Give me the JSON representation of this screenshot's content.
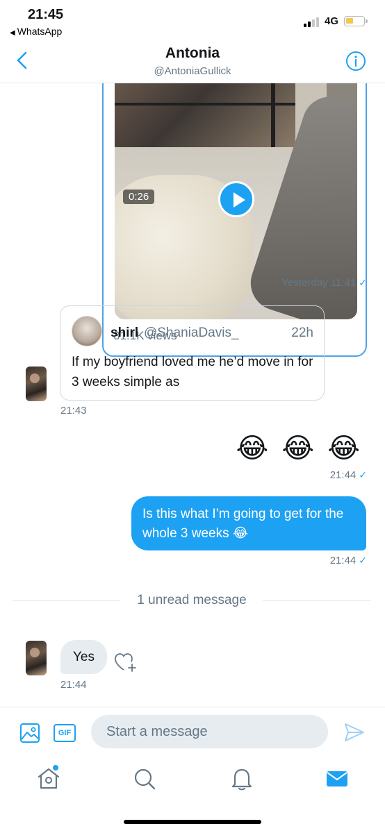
{
  "status_bar": {
    "time": "21:45",
    "back_app": "WhatsApp",
    "network": "4G"
  },
  "header": {
    "name": "Antonia",
    "handle": "@AntoniaGullick"
  },
  "messages": {
    "video": {
      "duration": "0:26",
      "views": "31.1K views",
      "timestamp": "Yesterday 11:41"
    },
    "quote_tweet": {
      "author_name": "shirl",
      "author_handle": "@ShaniaDavis_",
      "age": "22h",
      "text": "If my boyfriend loved me he’d move in for 3 weeks simple as",
      "timestamp": "21:43"
    },
    "emoji_message": {
      "text": "😂 😂 😂",
      "timestamp": "21:44"
    },
    "outgoing_text": {
      "text": "Is this what I’m going to get for the whole 3 weeks 😂",
      "timestamp": "21:44"
    },
    "unread_divider": "1 unread message",
    "incoming_text": {
      "text": "Yes",
      "timestamp": "21:44"
    }
  },
  "composer": {
    "placeholder": "Start a message",
    "gif_label": "GIF"
  },
  "colors": {
    "accent": "#1da1f2",
    "bubble_in": "#e6ecf0",
    "secondary_text": "#657786"
  },
  "icons": {
    "back": "chevron-left-icon",
    "info": "info-icon",
    "image": "image-icon",
    "gif": "gif-icon",
    "send": "send-icon",
    "home": "home-icon",
    "search": "search-icon",
    "notifications": "bell-icon",
    "messages": "envelope-icon",
    "react": "heart-plus-icon"
  }
}
